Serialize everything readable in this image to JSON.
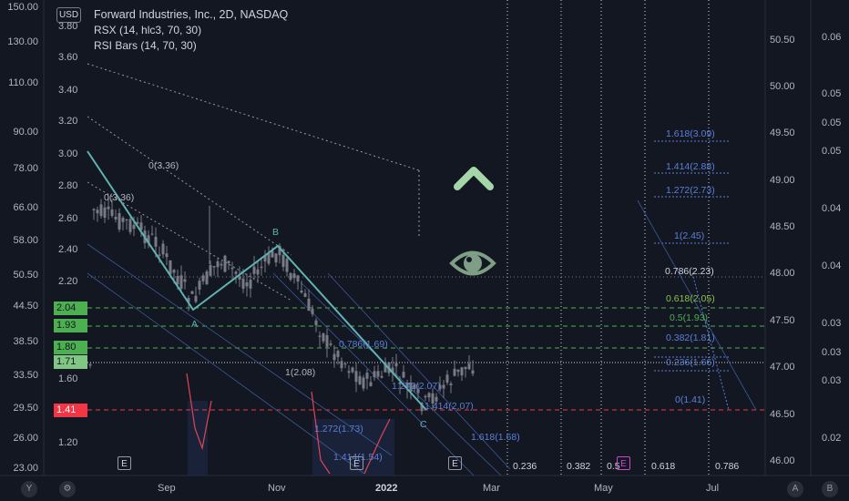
{
  "legend": {
    "title": "Forward Industries, Inc., 2D, NASDAQ",
    "line2": "RSX (14, hlc3, 70, 30)",
    "line3": "RSI Bars (14, 70, 30)"
  },
  "currency": "USD",
  "left_axis": [
    "150.00",
    "130.00",
    "110.00",
    "90.00",
    "78.00",
    "66.00",
    "58.00",
    "50.50",
    "44.50",
    "38.50",
    "33.50",
    "29.50",
    "26.00",
    "23.00"
  ],
  "overlay_axis": [
    "3.80",
    "3.60",
    "3.40",
    "3.20",
    "3.00",
    "2.80",
    "2.60",
    "2.40",
    "2.20",
    "1.60",
    "1.20"
  ],
  "right_axis": [
    "50.50",
    "50.00",
    "49.50",
    "49.00",
    "48.50",
    "48.00",
    "47.50",
    "47.00",
    "46.50",
    "46.00"
  ],
  "far_right_axis": [
    "0.06",
    "0.05",
    "0.05",
    "0.05",
    "0.04",
    "0.04",
    "0.03",
    "0.03",
    "0.03",
    "0.02"
  ],
  "price_tags": [
    {
      "label": "2.04",
      "color": "#4caf50"
    },
    {
      "label": "1.93",
      "color": "#4caf50"
    },
    {
      "label": "1.80",
      "color": "#4caf50"
    },
    {
      "label": "1.71",
      "color": "#81c784"
    },
    {
      "label": "1.41",
      "color": "#f23645"
    }
  ],
  "x_axis": [
    "Sep",
    "Nov",
    "2022",
    "Mar",
    "May",
    "Jul"
  ],
  "fib_retracement": [
    "1.618(3.09)",
    "1.414(2.88)",
    "1.272(2.73)",
    "1(2.45)",
    "0.786(2.23)",
    "0.618(2.05)",
    "0.5(1.93)",
    "0.382(1.81)",
    "0.236(1.66)",
    "0(1.41)"
  ],
  "fib_extension": [
    "0(3.36)",
    "0(3.36)",
    "1(2.08)",
    "1.272(1.73)",
    "1.414(1.54)",
    "1.414(2.07)",
    "1.618(1.68)",
    "1.272(2.07)",
    "0.786(1.69)"
  ],
  "time_fib": [
    "0.236",
    "0.382",
    "0.5",
    "0.618",
    "0.786"
  ],
  "wave_labels": [
    "A",
    "B",
    "C"
  ],
  "event_marker": "E",
  "bottom_buttons": {
    "left": "Y",
    "settings": "⚙",
    "right_a": "A",
    "right_b": "B"
  },
  "colors": {
    "bg": "#131722",
    "up": "#787b86",
    "down": "#787b86",
    "teal": "#5fb3b3",
    "green_dash": "#4caf50",
    "red_dash": "#f23645",
    "fib_blue": "#5b7fd6"
  }
}
